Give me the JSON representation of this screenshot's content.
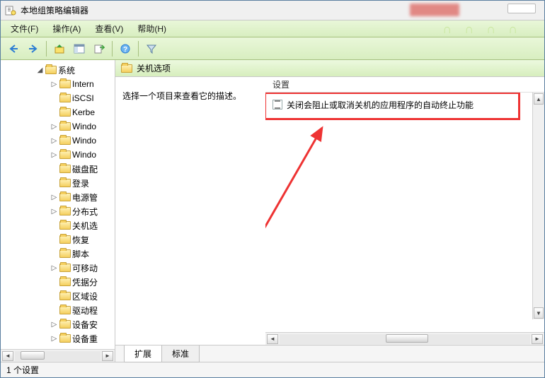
{
  "window_title": "本地组策略编辑器",
  "menu": {
    "file": "文件(F)",
    "action": "操作(A)",
    "view": "查看(V)",
    "help": "帮助(H)"
  },
  "tree": {
    "root": "系统",
    "items": [
      "Intern",
      "iSCSI",
      "Kerbe",
      "Windo",
      "Windo",
      "Windo",
      "磁盘配",
      "登录",
      "电源管",
      "分布式",
      "关机选",
      "恢复",
      "脚本",
      "可移动",
      "凭据分",
      "区域设",
      "驱动程",
      "设备安",
      "设备重"
    ]
  },
  "header": "关机选项",
  "description": "选择一个项目来查看它的描述。",
  "column_header": "设置",
  "settings": [
    "关闭会阻止或取消关机的应用程序的自动终止功能"
  ],
  "tabs": {
    "ext": "扩展",
    "std": "标准"
  },
  "status": "1 个设置"
}
